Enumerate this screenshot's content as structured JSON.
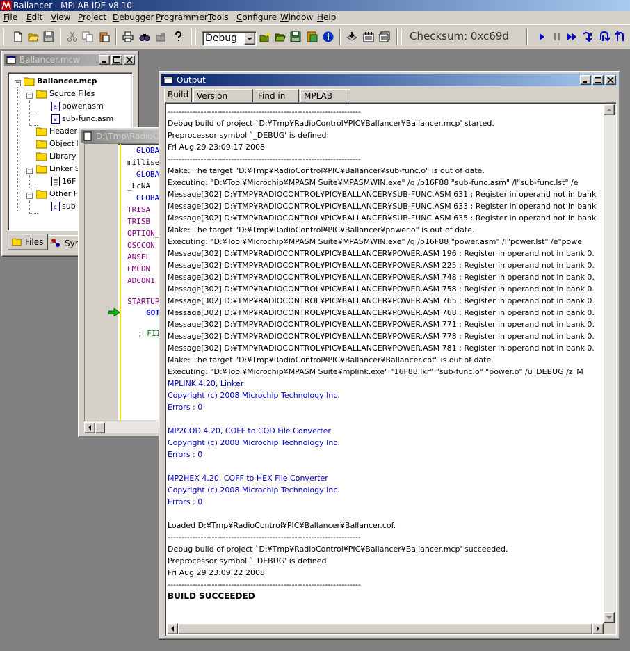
{
  "app": {
    "title": "Ballancer - MPLAB IDE v8.10"
  },
  "menu": [
    "File",
    "Edit",
    "View",
    "Project",
    "Debugger",
    "Programmer",
    "Tools",
    "Configure",
    "Window",
    "Help"
  ],
  "toolbar": {
    "config": "Debug",
    "checksum": "Checksum: 0xc69d"
  },
  "project_window": {
    "title": "Ballancer.mcw",
    "root": "Ballancer.mcp",
    "folders": {
      "source": "Source Files",
      "header": "Header",
      "object": "Object I",
      "library": "Library",
      "linker": "Linker S",
      "other": "Other F"
    },
    "files": {
      "power": "power.asm",
      "subfunc": "sub-func.asm",
      "linker_file": "16F",
      "other_file": "sub"
    },
    "tabs": {
      "files": "Files",
      "symbols": "Syr"
    }
  },
  "editor_window": {
    "title": "D:\\Tmp\\RadioCo",
    "lines": [
      "GLOBA",
      "millise",
      "GLOBA",
      "_LcNA",
      "GLOBA",
      "TRISA",
      "TRISB",
      "OPTION_",
      "OSCCON",
      "ANSEL",
      "CMCON",
      "ADCON1",
      "",
      "STARTUP",
      "GOT",
      "",
      "; FII"
    ]
  },
  "output_window": {
    "title": "Output",
    "tabs": [
      "Build",
      "Version Control",
      "Find in Files",
      "MPLAB SIM"
    ],
    "lines": [
      {
        "t": "----------------------------------------------------------------------",
        "c": "dash"
      },
      {
        "t": "Debug build of project `D:¥Tmp¥RadioControl¥PIC¥Ballancer¥Ballancer.mcp' started.",
        "c": ""
      },
      {
        "t": "Preprocessor symbol `_DEBUG' is defined.",
        "c": ""
      },
      {
        "t": "Fri Aug 29 23:09:17 2008",
        "c": ""
      },
      {
        "t": "----------------------------------------------------------------------",
        "c": "dash"
      },
      {
        "t": "Make: The target \"D:¥Tmp¥RadioControl¥PIC¥Ballancer¥sub-func.o\" is out of date.",
        "c": ""
      },
      {
        "t": "Executing: \"D:¥Tool¥Microchip¥MPASM Suite¥MPASMWIN.exe\" /q /p16F88 \"sub-func.asm\" /l\"sub-func.lst\" /e",
        "c": ""
      },
      {
        "t": "Message[302] D:¥TMP¥RADIOCONTROL¥PIC¥BALLANCER¥SUB-FUNC.ASM 631 : Register in operand not in bank",
        "c": ""
      },
      {
        "t": "Message[302] D:¥TMP¥RADIOCONTROL¥PIC¥BALLANCER¥SUB-FUNC.ASM 633 : Register in operand not in bank",
        "c": ""
      },
      {
        "t": "Message[302] D:¥TMP¥RADIOCONTROL¥PIC¥BALLANCER¥SUB-FUNC.ASM 635 : Register in operand not in bank",
        "c": ""
      },
      {
        "t": "Make: The target \"D:¥Tmp¥RadioControl¥PIC¥Ballancer¥power.o\" is out of date.",
        "c": ""
      },
      {
        "t": "Executing: \"D:¥Tool¥Microchip¥MPASM Suite¥MPASMWIN.exe\" /q /p16F88 \"power.asm\" /l\"power.lst\" /e\"powe",
        "c": ""
      },
      {
        "t": "Message[302] D:¥TMP¥RADIOCONTROL¥PIC¥BALLANCER¥POWER.ASM 196 : Register in operand not in bank 0.",
        "c": ""
      },
      {
        "t": "Message[302] D:¥TMP¥RADIOCONTROL¥PIC¥BALLANCER¥POWER.ASM 225 : Register in operand not in bank 0.",
        "c": ""
      },
      {
        "t": "Message[302] D:¥TMP¥RADIOCONTROL¥PIC¥BALLANCER¥POWER.ASM 748 : Register in operand not in bank 0.",
        "c": ""
      },
      {
        "t": "Message[302] D:¥TMP¥RADIOCONTROL¥PIC¥BALLANCER¥POWER.ASM 758 : Register in operand not in bank 0.",
        "c": ""
      },
      {
        "t": "Message[302] D:¥TMP¥RADIOCONTROL¥PIC¥BALLANCER¥POWER.ASM 765 : Register in operand not in bank 0.",
        "c": ""
      },
      {
        "t": "Message[302] D:¥TMP¥RADIOCONTROL¥PIC¥BALLANCER¥POWER.ASM 768 : Register in operand not in bank 0.",
        "c": ""
      },
      {
        "t": "Message[302] D:¥TMP¥RADIOCONTROL¥PIC¥BALLANCER¥POWER.ASM 771 : Register in operand not in bank 0.",
        "c": ""
      },
      {
        "t": "Message[302] D:¥TMP¥RADIOCONTROL¥PIC¥BALLANCER¥POWER.ASM 778 : Register in operand not in bank 0.",
        "c": ""
      },
      {
        "t": "Message[302] D:¥TMP¥RADIOCONTROL¥PIC¥BALLANCER¥POWER.ASM 781 : Register in operand not in bank 0.",
        "c": ""
      },
      {
        "t": "Make: The target \"D:¥Tmp¥RadioControl¥PIC¥Ballancer¥Ballancer.cof\" is out of date.",
        "c": ""
      },
      {
        "t": "Executing: \"D:¥Tool¥Microchip¥MPASM Suite¥mplink.exe\" \"16F88.lkr\" \"sub-func.o\" \"power.o\" /u_DEBUG /z_M",
        "c": ""
      },
      {
        "t": "MPLINK 4.20, Linker",
        "c": "blue"
      },
      {
        "t": "Copyright (c) 2008 Microchip Technology Inc.",
        "c": "blue"
      },
      {
        "t": "Errors    : 0",
        "c": "blue"
      },
      {
        "t": "",
        "c": ""
      },
      {
        "t": "MP2COD 4.20, COFF to COD File Converter",
        "c": "blue"
      },
      {
        "t": "Copyright (c) 2008 Microchip Technology Inc.",
        "c": "blue"
      },
      {
        "t": "Errors    : 0",
        "c": "blue"
      },
      {
        "t": "",
        "c": ""
      },
      {
        "t": "MP2HEX 4.20, COFF to HEX File Converter",
        "c": "blue"
      },
      {
        "t": "Copyright (c) 2008 Microchip Technology Inc.",
        "c": "blue"
      },
      {
        "t": "Errors    : 0",
        "c": "blue"
      },
      {
        "t": "",
        "c": ""
      },
      {
        "t": "Loaded D:¥Tmp¥RadioControl¥PIC¥Ballancer¥Ballancer.cof.",
        "c": ""
      },
      {
        "t": "----------------------------------------------------------------------",
        "c": "dash"
      },
      {
        "t": "Debug build of project `D:¥Tmp¥RadioControl¥PIC¥Ballancer¥Ballancer.mcp' succeeded.",
        "c": ""
      },
      {
        "t": "Preprocessor symbol `_DEBUG' is defined.",
        "c": ""
      },
      {
        "t": "Fri Aug 29 23:09:22 2008",
        "c": ""
      },
      {
        "t": "----------------------------------------------------------------------",
        "c": "dash"
      },
      {
        "t": "BUILD SUCCEEDED",
        "c": "bold"
      }
    ]
  },
  "icons": {
    "app_logo": "microchip-logo-icon",
    "toolbar": [
      "new-file-icon",
      "open-icon",
      "save-icon",
      "cut-icon",
      "copy-icon",
      "paste-icon",
      "print-icon",
      "find-icon",
      "find-in-files-icon",
      "help-icon",
      "new-project-icon",
      "open-project-icon",
      "save-project-icon",
      "project-settings-icon",
      "info-icon",
      "build-icon",
      "make-icon",
      "build-all-icon",
      "run-icon",
      "halt-icon",
      "animate-icon",
      "step-into-icon",
      "step-over-icon",
      "step-out-icon"
    ]
  },
  "colors": {
    "active_title": "#0a246a",
    "inactive_title": "#808080",
    "build_output_blue": "#0000c0",
    "debugger_blue": "#0000cc",
    "pc_arrow": "#00c000"
  }
}
